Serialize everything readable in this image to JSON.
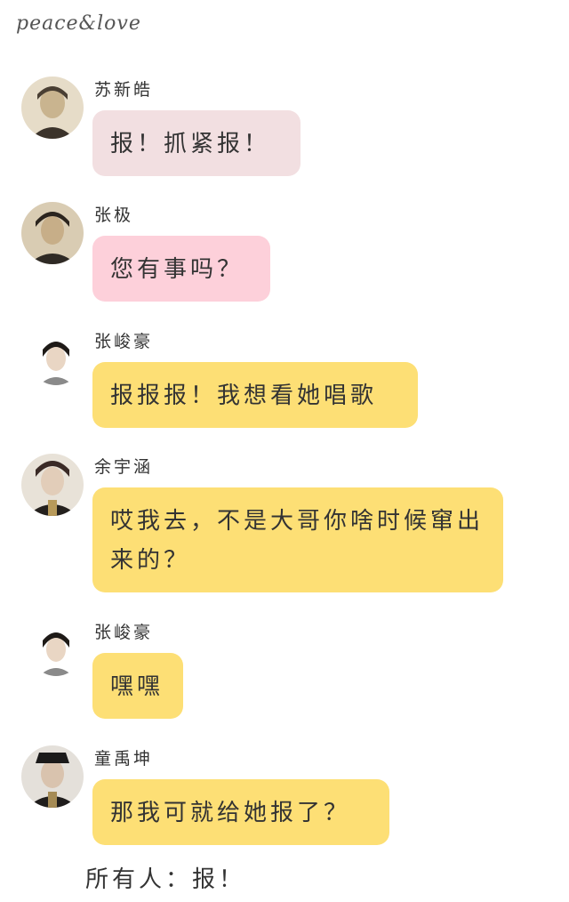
{
  "header": {
    "title": "peace&love"
  },
  "colors": {
    "bubble_pink_light": "#f2dfe1",
    "bubble_pink": "#fdd0da",
    "bubble_yellow": "#fddf75"
  },
  "messages": [
    {
      "sender": "苏新皓",
      "text": "报！抓紧报！",
      "bubble_color": "#f2dfe1",
      "avatar": "avatar-photo"
    },
    {
      "sender": "张极",
      "text": "您有事吗？",
      "bubble_color": "#fdd0da",
      "avatar": "avatar-photo"
    },
    {
      "sender": "张峻豪",
      "text": "报报报！我想看她唱歌",
      "bubble_color": "#fddf75",
      "avatar": "avatar-photo"
    },
    {
      "sender": "余宇涵",
      "text": "哎我去，不是大哥你啥时候窜出来的？",
      "bubble_color": "#fddf75",
      "avatar": "avatar-photo"
    },
    {
      "sender": "张峻豪",
      "text": "嘿嘿",
      "bubble_color": "#fddf75",
      "avatar": "avatar-photo"
    },
    {
      "sender": "童禹坤",
      "text": "那我可就给她报了？",
      "bubble_color": "#fddf75",
      "avatar": "avatar-photo"
    }
  ],
  "footer": {
    "text": "所有人：报！"
  }
}
